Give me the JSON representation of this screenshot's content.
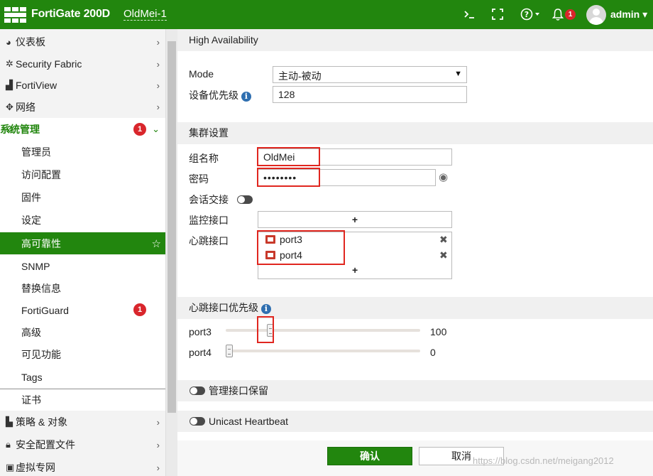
{
  "topbar": {
    "brand": "FortiGate 200D",
    "hostname": "OldMei-1",
    "user": "admin",
    "notification_count": "1",
    "icons": [
      "cli-console-icon",
      "fullscreen-icon",
      "help-icon",
      "bell-icon"
    ]
  },
  "sidebar": {
    "items": [
      {
        "label": "仪表板",
        "icon": "dashboard-icon"
      },
      {
        "label": "Security Fabric",
        "icon": "fabric-icon"
      },
      {
        "label": "FortiView",
        "icon": "chart-icon"
      },
      {
        "label": "网络",
        "icon": "network-icon"
      },
      {
        "label": "系统管理",
        "icon": "gear-icon",
        "badge": "1"
      },
      {
        "label": "管理员"
      },
      {
        "label": "访问配置"
      },
      {
        "label": "固件"
      },
      {
        "label": "设定"
      },
      {
        "label": "高可靠性"
      },
      {
        "label": "SNMP"
      },
      {
        "label": "替换信息"
      },
      {
        "label": "FortiGuard",
        "badge": "1"
      },
      {
        "label": "高级"
      },
      {
        "label": "可见功能"
      },
      {
        "label": "Tags"
      },
      {
        "label": "证书"
      },
      {
        "label": "策略 & 对象",
        "icon": "policy-icon"
      },
      {
        "label": "安全配置文件",
        "icon": "lock-icon"
      },
      {
        "label": "虚拟专网",
        "icon": "monitor-icon"
      }
    ]
  },
  "main": {
    "ha_title": "High Availability",
    "mode_label": "Mode",
    "mode_value": "主动-被动",
    "priority_label": "设备优先级",
    "priority_value": "128",
    "cluster_title": "集群设置",
    "group_name_label": "组名称",
    "group_name_value": "OldMei",
    "password_label": "密码",
    "password_value": "••••••••",
    "session_pickup_label": "会话交接",
    "monitor_label": "监控接口",
    "heartbeat_label": "心跳接口",
    "heartbeat_ports": [
      "port3",
      "port4"
    ],
    "hb_priority_title": "心跳接口优先级",
    "hb_priorities": [
      {
        "port": "port3",
        "value": "100",
        "level": 0.22
      },
      {
        "port": "port4",
        "value": "0",
        "level": 0.0
      }
    ],
    "mgmt_reserve_label": "管理接口保留",
    "unicast_label": "Unicast Heartbeat",
    "ok_label": "确认",
    "cancel_label": "取消"
  },
  "watermark": "https://blog.csdn.net/meigang2012",
  "colors": {
    "brand_green": "#22860e",
    "badge_red": "#d9262c",
    "highlight_red": "#e0261f"
  }
}
